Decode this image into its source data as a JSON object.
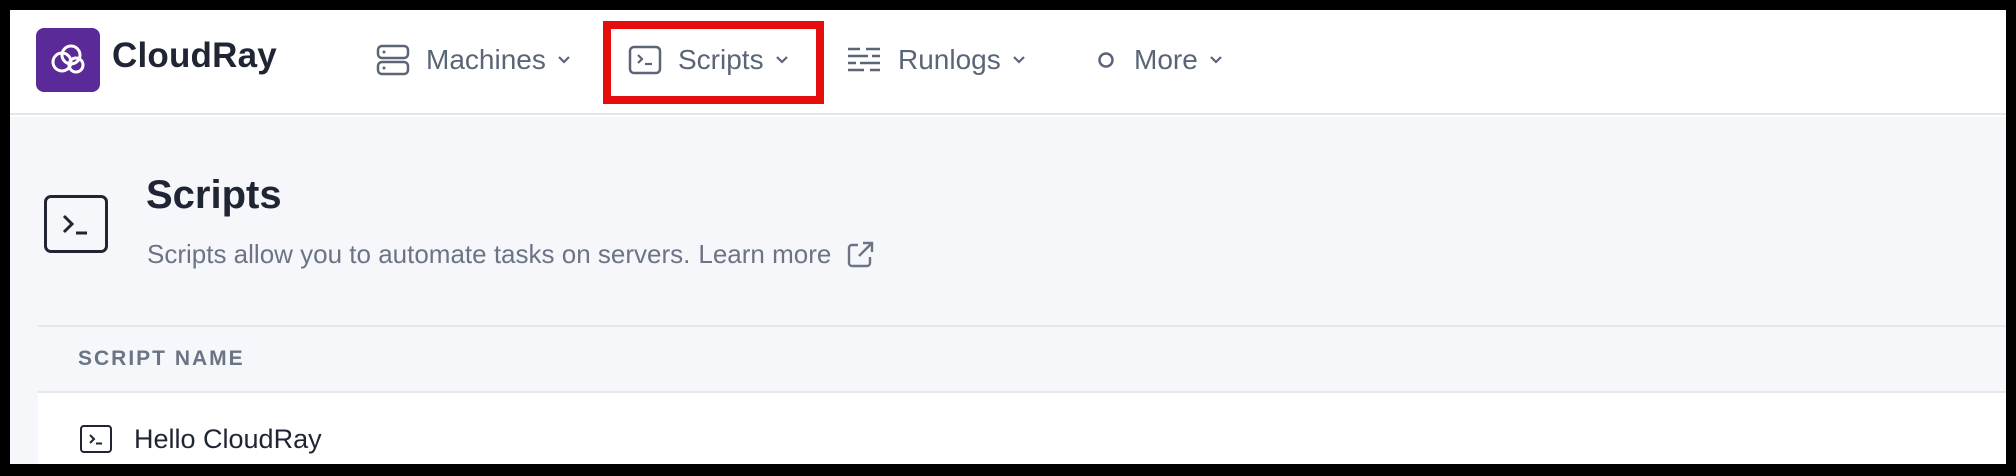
{
  "app": {
    "brand": "CloudRay",
    "brand_color": "#5b2a99"
  },
  "nav": {
    "items": [
      {
        "label": "Machines",
        "icon": "server-icon"
      },
      {
        "label": "Scripts",
        "icon": "terminal-icon"
      },
      {
        "label": "Runlogs",
        "icon": "logs-icon"
      },
      {
        "label": "More",
        "icon": "circle-icon"
      }
    ],
    "highlighted": "Scripts",
    "highlight_color": "#e60d0d"
  },
  "page": {
    "title": "Scripts",
    "description": "Scripts allow you to automate tasks on servers.",
    "learn_more": "Learn more"
  },
  "table": {
    "columns": [
      "SCRIPT NAME"
    ],
    "rows": [
      {
        "name": "Hello CloudRay",
        "icon": "terminal-icon"
      }
    ]
  }
}
